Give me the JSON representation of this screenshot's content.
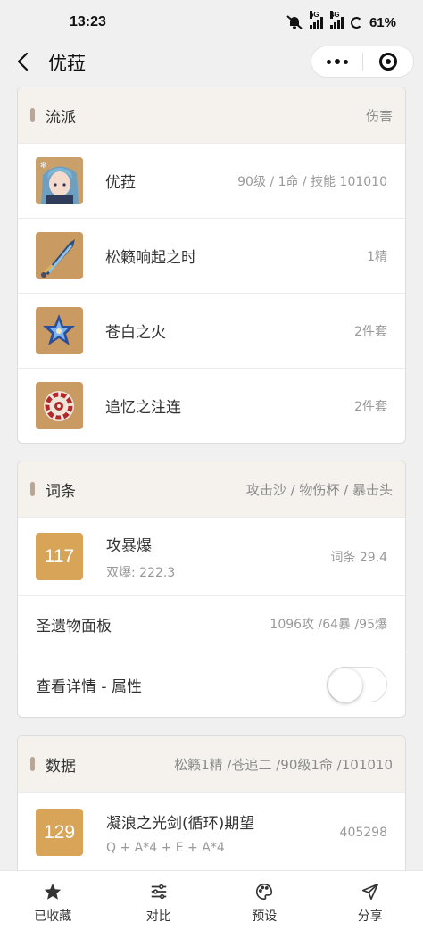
{
  "status": {
    "time": "13:23",
    "battery": "61%",
    "net1": "5G",
    "net2": "4G"
  },
  "nav": {
    "title": "优菈"
  },
  "build": {
    "title": "流派",
    "tag": "伤害",
    "items": [
      {
        "name": "优菈",
        "value": "90级 / 1命 / 技能 101010",
        "icon": "eula-portrait-icon"
      },
      {
        "name": "松籁响起之时",
        "value": "1精",
        "icon": "greatsword-icon"
      },
      {
        "name": "苍白之火",
        "value": "2件套",
        "icon": "pale-flame-flower-icon"
      },
      {
        "name": "追忆之注连",
        "value": "2件套",
        "icon": "shimenawa-flower-icon"
      }
    ]
  },
  "stats": {
    "title": "词条",
    "tag": "攻击沙 / 物伤杯 / 暴击头",
    "score": "117",
    "score_name": "攻暴爆",
    "score_sub": "双爆: 222.3",
    "score_value": "词条 29.4",
    "panel_label": "圣遗物面板",
    "panel_value": "1096攻 /64暴 /95爆",
    "detail_label": "查看详情 - 属性",
    "detail_on": false
  },
  "data": {
    "title": "数据",
    "tag": "松籁1精 /苍追二 /90级1命 /101010",
    "score": "129",
    "name": "凝浪之光剑(循环)期望",
    "formula": "Q + A*4 + E + A*4",
    "value": "405298"
  },
  "tabs": [
    {
      "label": "已收藏",
      "icon": "star-icon"
    },
    {
      "label": "对比",
      "icon": "sliders-icon"
    },
    {
      "label": "预设",
      "icon": "palette-icon"
    },
    {
      "label": "分享",
      "icon": "send-icon"
    }
  ],
  "colors": {
    "accent": "#d8a457",
    "header_bg": "#f5f2ee",
    "bar": "#b8a697"
  }
}
